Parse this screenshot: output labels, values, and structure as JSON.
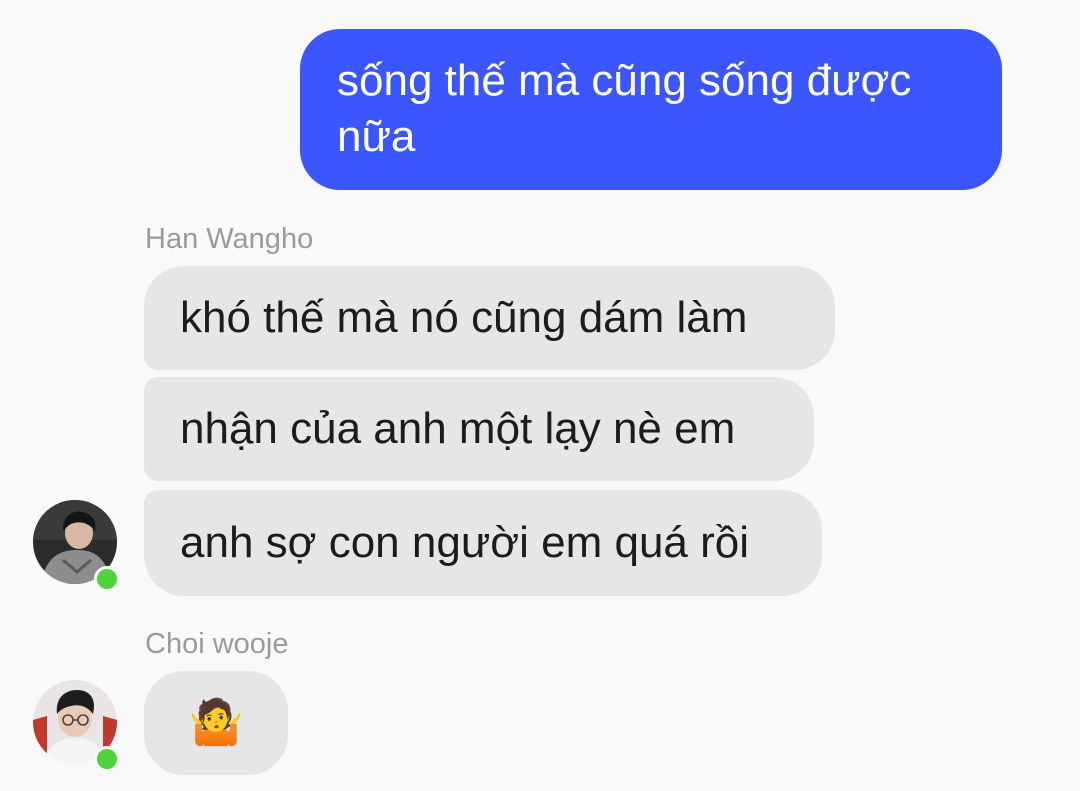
{
  "colors": {
    "outgoing_bubble": "#3b55ff",
    "incoming_bubble": "#e6e6e6",
    "online_indicator": "#4fd33a"
  },
  "outgoing": [
    {
      "text": "sống thế mà cũng sống được nữa"
    }
  ],
  "groups": [
    {
      "sender": "Han Wangho",
      "avatar": "person-avatar-dark-hoodie",
      "online": true,
      "messages": [
        "khó thế mà nó cũng dám làm",
        "nhận của anh một lạy nè em",
        "anh sợ con người em quá rồi"
      ]
    },
    {
      "sender": "Choi wooje",
      "avatar": "person-avatar-glasses",
      "online": true,
      "messages": [
        "🤷"
      ]
    }
  ]
}
